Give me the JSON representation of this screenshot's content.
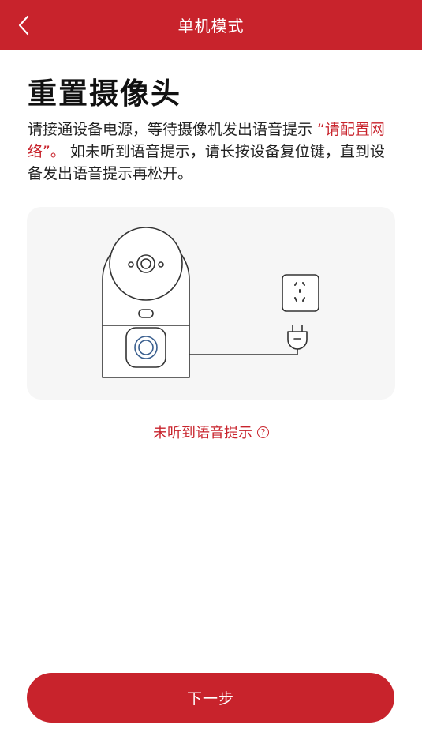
{
  "header": {
    "title": "单机模式",
    "back_icon": "chevron-left-icon"
  },
  "main": {
    "title": "重置摄像头",
    "desc_part1": "请接通设备电源，等待摄像机发出语音提示 ",
    "desc_highlight": "“请配置网络”。",
    "desc_part2": " 如未听到语音提示，请长按设备复位键，直到设备发出语音提示再松开。"
  },
  "illustration": {
    "name": "camera-and-power-outlet-illustration"
  },
  "hint": {
    "label": "未听到语音提示",
    "icon": "question-circle-icon",
    "icon_glyph": "?"
  },
  "footer": {
    "next_label": "下一步"
  },
  "colors": {
    "brand": "#c8232c",
    "text": "#222222",
    "panel_bg": "#f6f6f6"
  }
}
